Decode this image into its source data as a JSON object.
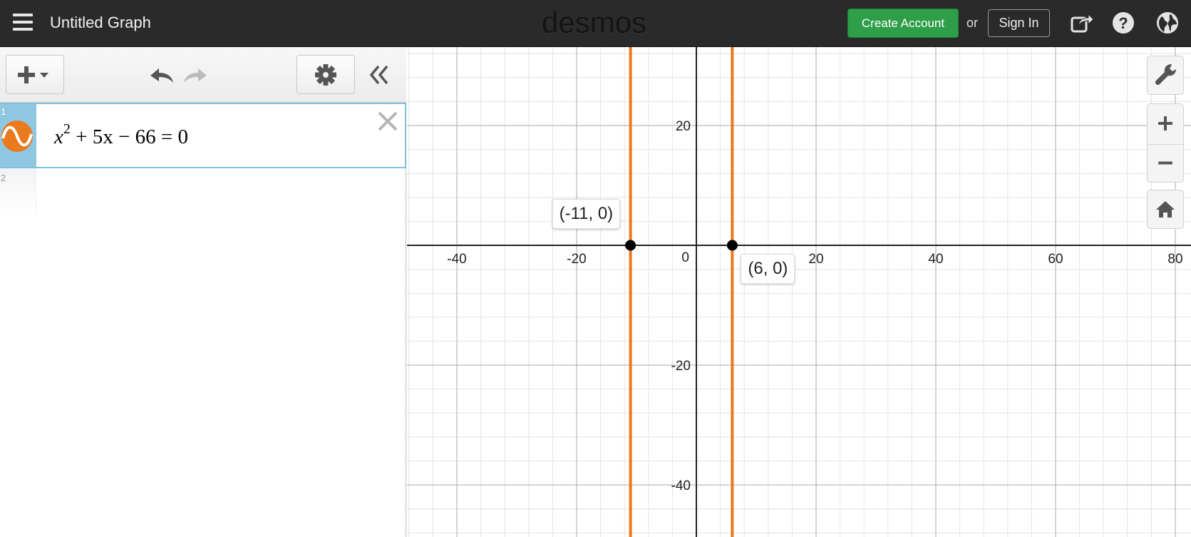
{
  "header": {
    "title": "Untitled Graph",
    "logo": "desmos",
    "create_account_label": "Create Account",
    "or_label": "or",
    "sign_in_label": "Sign In"
  },
  "expressions": [
    {
      "index": "1",
      "latex_base": "x",
      "latex_exp": "2",
      "latex_rest": " + 5x − 66 = 0",
      "color": "#e97a1e"
    },
    {
      "index": "2"
    }
  ],
  "graph": {
    "x_tick_labels": [
      "-40",
      "-20",
      "0",
      "20",
      "40",
      "60",
      "80"
    ],
    "y_tick_labels": [
      "20",
      "-20",
      "-40"
    ],
    "x_ticks": [
      -40,
      -20,
      20,
      40,
      60,
      80
    ],
    "y_ticks": [
      20,
      -20,
      -40
    ],
    "vertical_lines_at": [
      -11,
      6
    ],
    "points": [
      {
        "label": "(-11, 0)",
        "x": -11,
        "y": 0
      },
      {
        "label": "(6, 0)",
        "x": 6,
        "y": 0
      }
    ],
    "line_color": "#e9781e",
    "grid": true
  },
  "icons": {
    "menu": "hamburger-icon",
    "share": "share-icon",
    "help": "help-icon",
    "language": "globe-icon",
    "add": "plus-icon",
    "undo": "undo-icon",
    "redo": "redo-icon",
    "settings": "gear-icon",
    "collapse": "double-chevron-left-icon",
    "wrench": "wrench-icon",
    "zoom_in": "plus-icon",
    "zoom_out": "minus-icon",
    "home": "home-icon",
    "delete": "close-icon",
    "curve": "sine-wave-icon"
  },
  "colors": {
    "topbar": "#2a2a2a",
    "create_account": "#2e9e48",
    "selected_row": "#8fc7e0",
    "curve": "#e9781e"
  }
}
